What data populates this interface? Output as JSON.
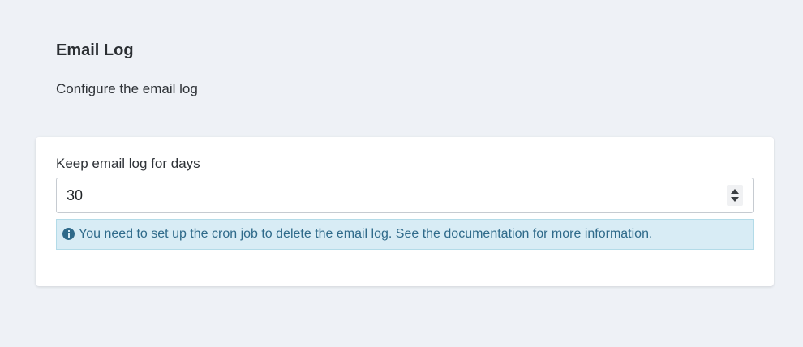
{
  "section": {
    "title": "Email Log",
    "description": "Configure the email log"
  },
  "form": {
    "keep_log_label": "Keep email log for days",
    "keep_log_value": "30",
    "info_icon": "info-circle-icon",
    "info_message": "You need to set up the cron job to delete the email log. See the documentation for more information."
  },
  "colors": {
    "page_background": "#eef1f6",
    "card_background": "#ffffff",
    "alert_background": "#d8ecf5",
    "alert_border": "#b3dbe8",
    "alert_text": "#2f6a8a"
  }
}
